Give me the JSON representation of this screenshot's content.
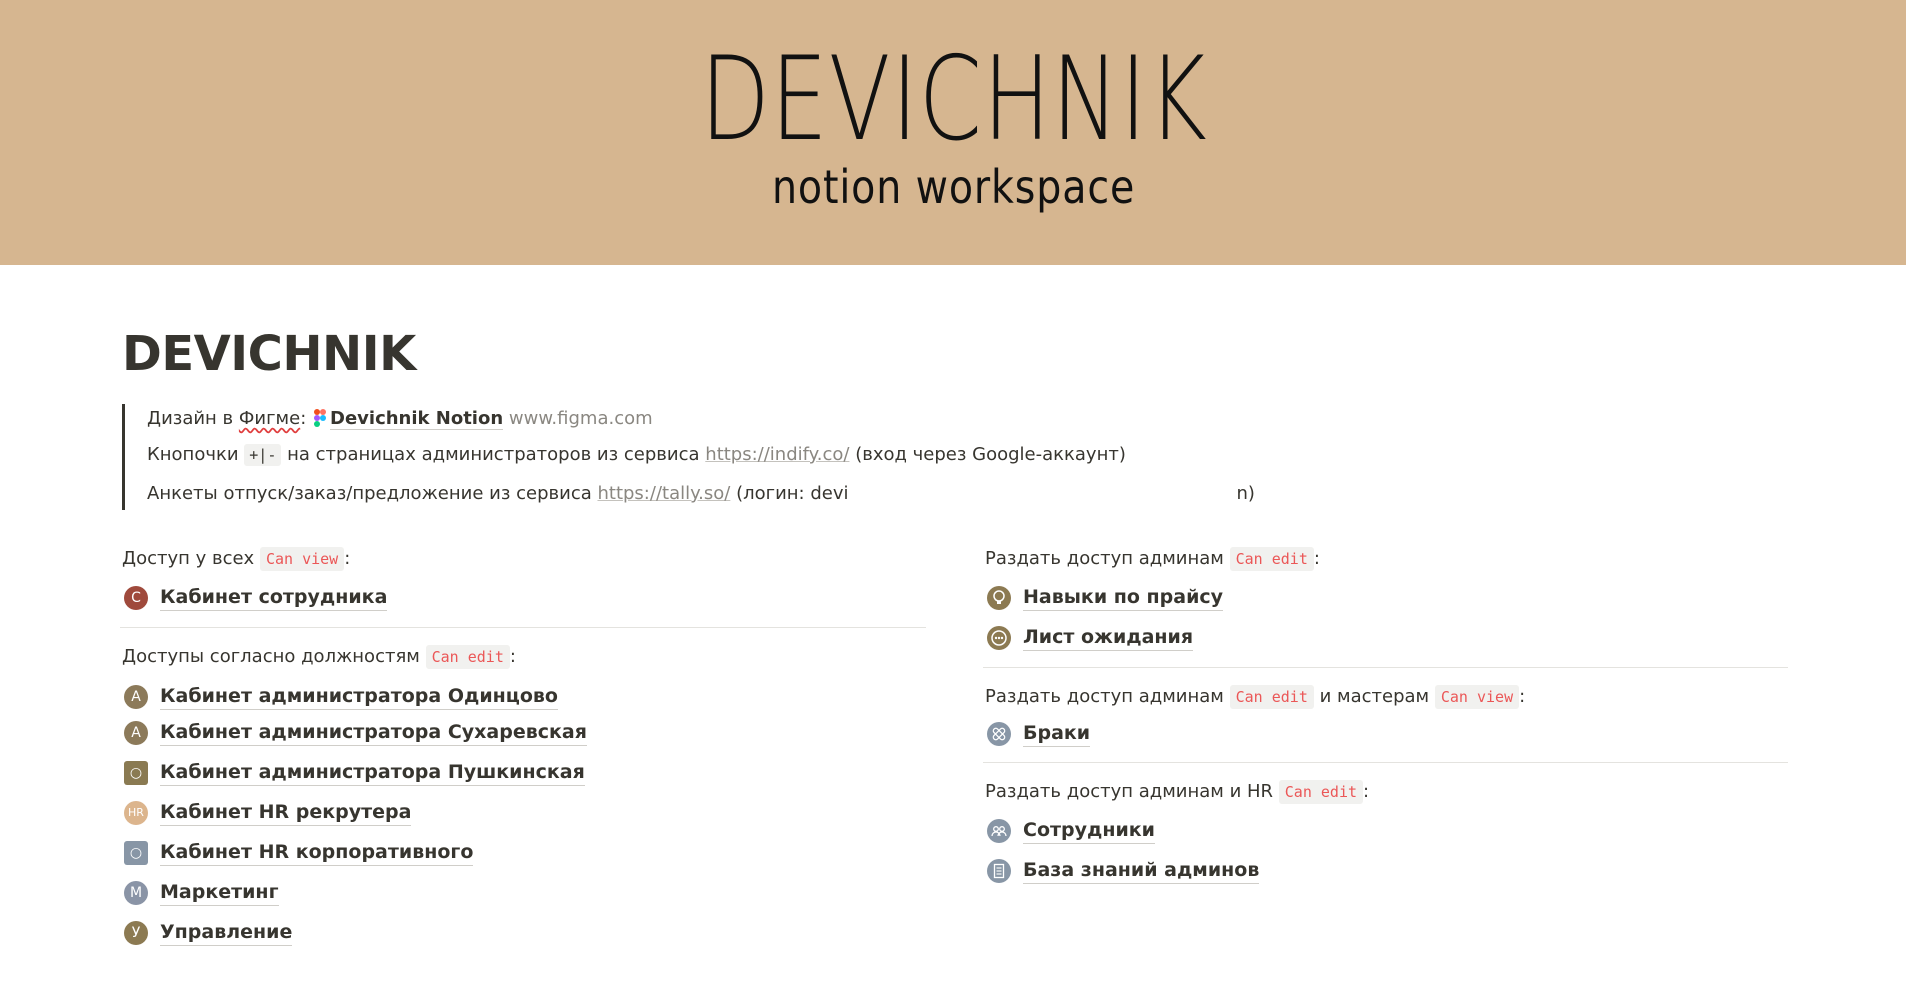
{
  "cover": {
    "title": "DEVICHNIK",
    "subtitle": "notion workspace",
    "background": "#d6b690"
  },
  "page": {
    "title": "DEVICHNIK"
  },
  "quote": {
    "line1": {
      "prefix": "Дизайн в ",
      "figma_word": "Фигме",
      "colon": ":",
      "link_title": "Devichnik Notion",
      "domain": "www.figma.com"
    },
    "line2": {
      "prefix": "Кнопочки",
      "code": "+|-",
      "middle": "на страницах администраторов из сервиса",
      "url": "https://indify.co/",
      "suffix": "(вход через Google-аккаунт)"
    },
    "line3": {
      "prefix": "Анкеты отпуск/заказ/предложение из сервиса",
      "url": "https://tally.so/",
      "login_prefix": "(логин: devi",
      "login_suffix": "n)"
    }
  },
  "left": {
    "section1": {
      "label": "Доступ у всех",
      "badge": "Can view",
      "colon": ":",
      "items": [
        {
          "icon": "С",
          "icon_color": "#9f4a3c",
          "label": "Кабинет сотрудника"
        }
      ]
    },
    "section2": {
      "label": "Доступы согласно должностям",
      "badge": "Can edit",
      "colon": ":",
      "items": [
        {
          "icon": "А",
          "icon_color": "#8c7a5a",
          "label": "Кабинет администратора Одинцово"
        },
        {
          "icon": "А",
          "icon_color": "#8c7a5a",
          "label": "Кабинет администратора Сухаревская"
        },
        {
          "icon": "○",
          "icon_color": "#8a7a52",
          "label": "Кабинет администратора Пушкинская"
        },
        {
          "icon": "HR",
          "icon_color": "#dcb58d",
          "label": "Кабинет HR рекрутера"
        },
        {
          "icon": "○",
          "icon_color": "#8896a6",
          "label": "Кабинет HR корпоративного"
        },
        {
          "icon": "М",
          "icon_color": "#8a94a6",
          "label": "Маркетинг"
        },
        {
          "icon": "У",
          "icon_color": "#8c7a52",
          "label": "Управление"
        }
      ]
    }
  },
  "right": {
    "section1": {
      "label": "Раздать доступ админам",
      "badge": "Can edit",
      "colon": ":",
      "items": [
        {
          "icon": "lightbulb-icon",
          "icon_color": "#8c7a52",
          "label": "Навыки по прайсу"
        },
        {
          "icon": "dots-icon",
          "icon_color": "#8c7a52",
          "label": "Лист ожидания"
        }
      ]
    },
    "section2": {
      "label": "Раздать доступ админам",
      "badge1": "Can edit",
      "middle": "и мастерам",
      "badge2": "Can view",
      "colon": ":",
      "items": [
        {
          "icon": "bandage-icon",
          "icon_color": "#8896a6",
          "label": "Браки"
        }
      ]
    },
    "section3": {
      "label": "Раздать доступ админам и HR",
      "badge": "Can edit",
      "colon": ":",
      "items": [
        {
          "icon": "people-icon",
          "icon_color": "#8896a6",
          "label": "Сотрудники"
        },
        {
          "icon": "document-icon",
          "icon_color": "#8896a6",
          "label": "База знаний админов"
        }
      ]
    }
  }
}
